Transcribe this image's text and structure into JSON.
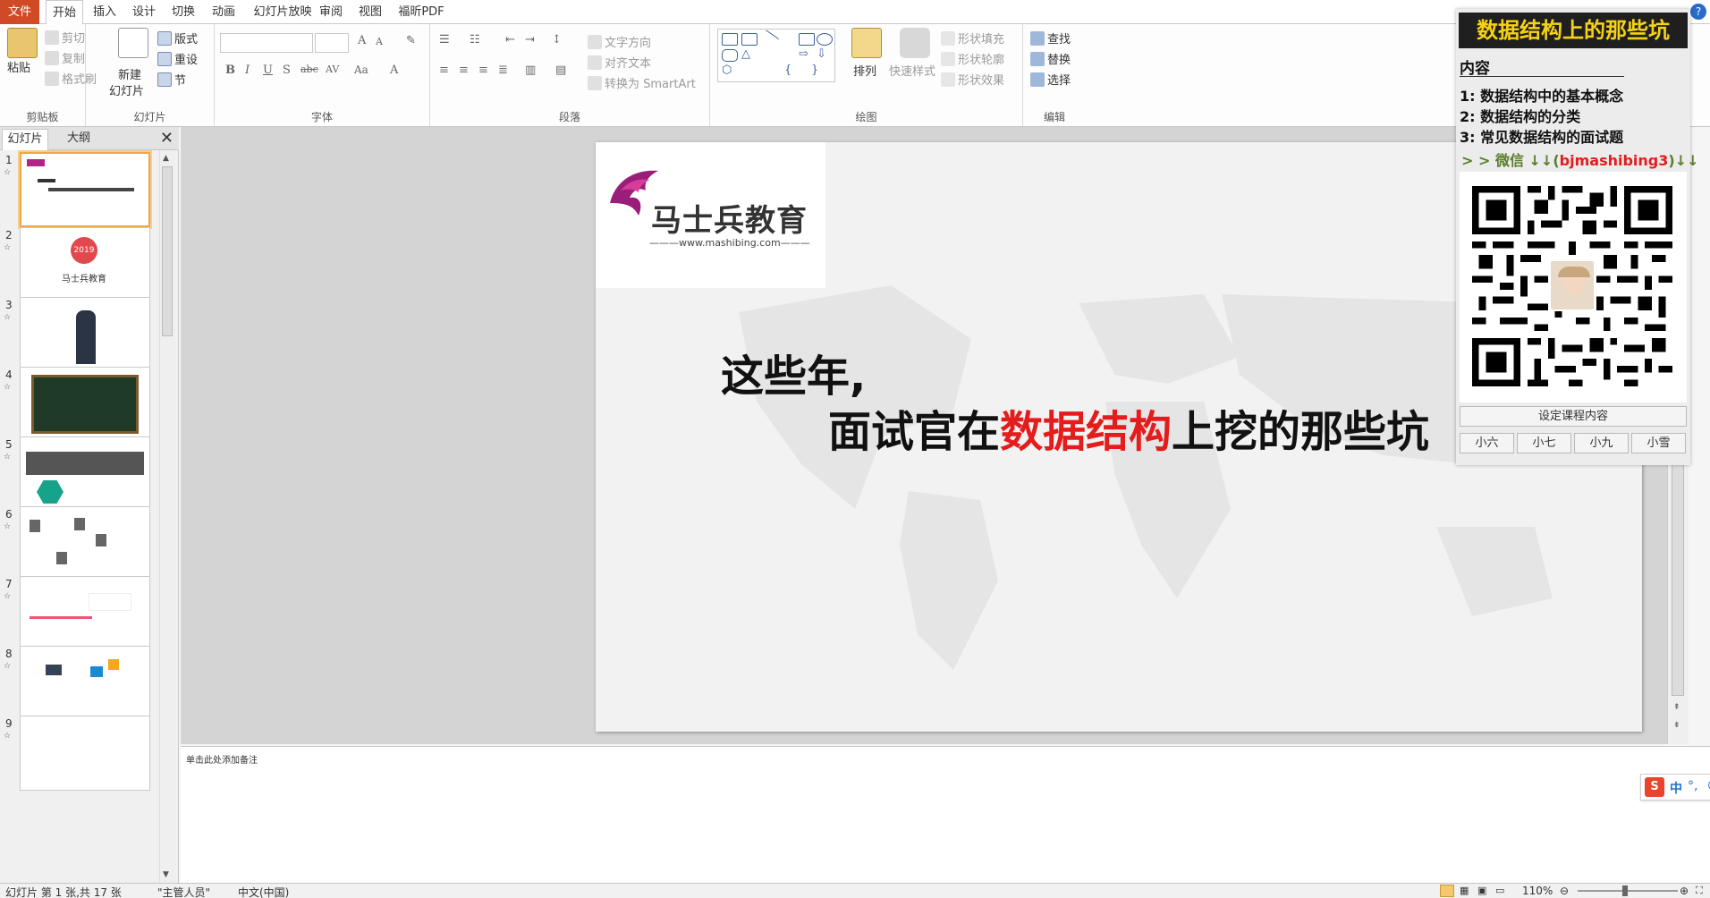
{
  "tabs": [
    {
      "label": "文件"
    },
    {
      "label": "开始"
    },
    {
      "label": "插入"
    },
    {
      "label": "设计"
    },
    {
      "label": "切换"
    },
    {
      "label": "动画"
    },
    {
      "label": "幻灯片放映"
    },
    {
      "label": "审阅"
    },
    {
      "label": "视图"
    },
    {
      "label": "福昕PDF"
    }
  ],
  "ribbon": {
    "clipboard": {
      "paste": "粘贴",
      "cut": "剪切",
      "copy": "复制",
      "format_painter": "格式刷",
      "label": "剪贴板"
    },
    "slides": {
      "new_slide": "新建",
      "new_slide2": "幻灯片",
      "layout": "版式",
      "reset": "重设",
      "section": "节",
      "label": "幻灯片"
    },
    "font": {
      "label": "字体",
      "bold": "B",
      "italic": "I",
      "underline": "U",
      "strike": "S",
      "abc": "abc",
      "av": "AV",
      "aa": "Aa",
      "a": "A"
    },
    "paragraph": {
      "text_direction": "文字方向",
      "align_text": "对齐文本",
      "smartart": "转换为 SmartArt",
      "label": "段落"
    },
    "drawing": {
      "arrange": "排列",
      "quick_styles": "快速样式",
      "shape_fill": "形状填充",
      "shape_outline": "形状轮廓",
      "shape_effects": "形状效果",
      "label": "绘图"
    },
    "editing": {
      "find": "查找",
      "replace": "替换",
      "select": "选择",
      "label": "编辑"
    }
  },
  "panel": {
    "tab_slides": "幻灯片",
    "tab_outline": "大纲"
  },
  "thumbs": [
    {
      "num": "1"
    },
    {
      "num": "2",
      "year": "2019",
      "brand": "马士兵教育"
    },
    {
      "num": "3"
    },
    {
      "num": "4"
    },
    {
      "num": "5"
    },
    {
      "num": "6"
    },
    {
      "num": "7"
    },
    {
      "num": "8"
    },
    {
      "num": "9"
    }
  ],
  "slide": {
    "logo_text": "马士兵教育",
    "logo_url": "www.mashibing.com",
    "title_line1": "这些年,",
    "title_pre": "面试官在",
    "title_hl": "数据结构",
    "title_post": "上挖的那些坑"
  },
  "notes": {
    "placeholder": "单击此处添加备注"
  },
  "status": {
    "slide_info": "幻灯片 第 1 张,共 17 张",
    "theme": "\"主管人员\"",
    "lang": "中文(中国)",
    "zoom": "110%"
  },
  "overlay": {
    "title": "数据结构上的那些坑",
    "subtitle": "内容",
    "items": [
      "1: 数据结构中的基本概念",
      "2: 数据结构的分类",
      "3: 常见数据结构的面试题"
    ],
    "wechat_prefix": "> > 微信 ↓↓(",
    "wechat_id": "bjmashibing3",
    "wechat_suffix": ")↓↓",
    "set_button": "设定课程内容",
    "names": [
      "小六",
      "小七",
      "小九",
      "小雪"
    ]
  },
  "ime": {
    "lang": "中"
  },
  "colors": {
    "file_tab": "#d04b25",
    "accent_red": "#e51c1c",
    "overlay_title": "#f6d216",
    "logo_purple": "#9b1d7a"
  }
}
